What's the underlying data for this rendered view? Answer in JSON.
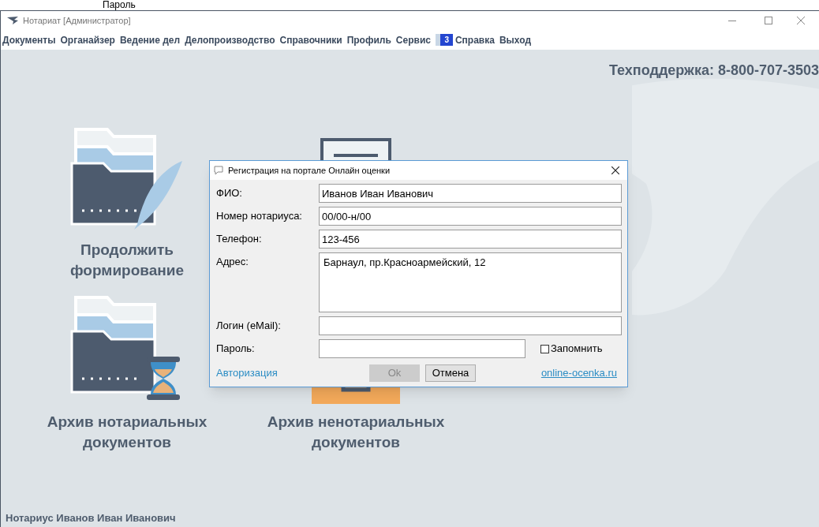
{
  "top_caption": "Пароль",
  "window": {
    "title": "Нотариат [Администратор]"
  },
  "menu": [
    {
      "kind": "item",
      "label": "Документы"
    },
    {
      "kind": "item",
      "label": "Органайзер"
    },
    {
      "kind": "item",
      "label": "Ведение дел"
    },
    {
      "kind": "item",
      "label": "Делопроизводство"
    },
    {
      "kind": "item",
      "label": "Справочники"
    },
    {
      "kind": "item",
      "label": "Профиль"
    },
    {
      "kind": "item",
      "label": "Сервис"
    },
    {
      "kind": "badge",
      "label": "3"
    },
    {
      "kind": "item",
      "label": "Справка"
    },
    {
      "kind": "item",
      "label": "Выход"
    }
  ],
  "support": "Техподдержка: 8-800-707-3503",
  "tiles": [
    {
      "kind": "folder-feather",
      "label": "Продолжить формирование"
    },
    {
      "kind": "document"
    },
    {
      "kind": "folder-hourglass",
      "label": "Архив нотариальных документов"
    },
    {
      "kind": "box",
      "label": "Архив ненотариальных документов"
    }
  ],
  "status": "Нотариус Иванов Иван Иванович",
  "dialog": {
    "title": "Регистрация на портале Онлайн оценки",
    "fields": [
      {
        "kind": "text",
        "label": "ФИО:",
        "value": "Иванов Иван Иванович"
      },
      {
        "kind": "text",
        "label": "Номер нотариуса:",
        "value": "00/00-н/00"
      },
      {
        "kind": "text",
        "label": "Телефон:",
        "value": "123-456"
      },
      {
        "kind": "textarea",
        "label": "Адрес:",
        "value": "Барнаул, пр.Красноармейский, 12"
      },
      {
        "kind": "text",
        "label": "Логин (eMail):"
      },
      {
        "kind": "password",
        "label": "Пароль:"
      }
    ],
    "remember": {
      "label": "Запомнить",
      "checked": false
    },
    "auth_link": "Авторизация",
    "buttons": [
      {
        "label": "Ok",
        "disabled": true
      },
      {
        "label": "Отмена",
        "disabled": false
      }
    ],
    "site_link": "online-ocenka.ru"
  }
}
